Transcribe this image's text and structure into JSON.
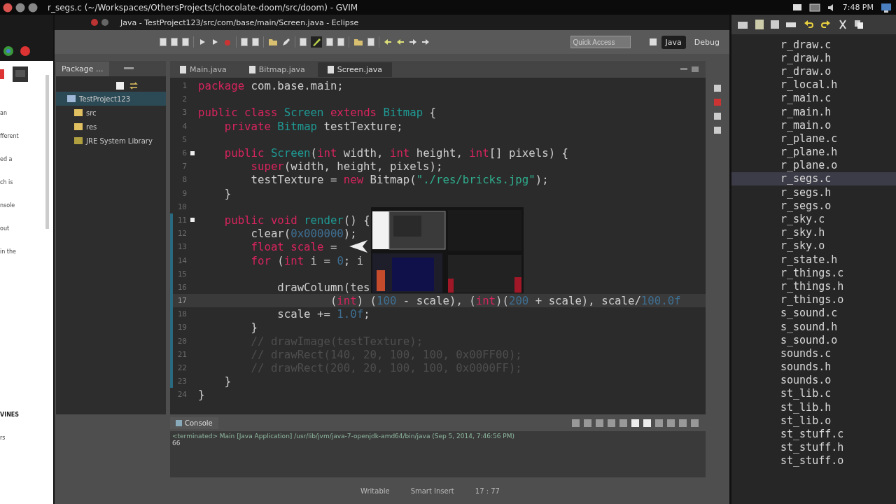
{
  "top_bar": {
    "title": "r_segs.c (~/Workspaces/OthersProjects/chocolate-doom/src/doom) - GVIM",
    "clock": "7:48 PM"
  },
  "left_window": {
    "fragments": [
      "an",
      "fferent",
      "ed a",
      "ch is",
      "nsole",
      "out",
      "in the",
      "VINES",
      "rs"
    ]
  },
  "eclipse": {
    "title": "Java - TestProject123/src/com/base/main/Screen.java - Eclipse",
    "quick_access": {
      "placeholder": "Quick Access"
    },
    "perspectives": [
      {
        "label": "Java",
        "selected": true
      },
      {
        "label": "Debug",
        "selected": false
      }
    ],
    "package_explorer": {
      "tab": "Package ...",
      "tree": [
        {
          "label": "TestProject123",
          "kind": "project",
          "selected": true,
          "children": [
            {
              "label": "src",
              "kind": "folder",
              "selected": false
            },
            {
              "label": "res",
              "kind": "folder",
              "selected": false
            },
            {
              "label": "JRE System Library",
              "kind": "library",
              "selected": false
            }
          ]
        }
      ]
    },
    "editor": {
      "tabs": [
        {
          "label": "Main.java",
          "selected": false
        },
        {
          "label": "Bitmap.java",
          "selected": false
        },
        {
          "label": "Screen.java",
          "selected": true
        }
      ],
      "lines": [
        {
          "number": "1",
          "current": false,
          "marker": false,
          "range": false,
          "tokens": [
            {
              "kind": "keyword",
              "text": "package"
            },
            {
              "kind": "plain",
              "text": " com.base.main;"
            }
          ]
        },
        {
          "number": "2",
          "current": false,
          "marker": false,
          "range": false
        },
        {
          "number": "3",
          "current": false,
          "marker": false,
          "range": false,
          "tokens": [
            {
              "kind": "keyword",
              "text": "public"
            },
            {
              "kind": "keyword",
              "text": " class"
            },
            {
              "kind": "type",
              "text": " Screen"
            },
            {
              "kind": "keyword",
              "text": " extends"
            },
            {
              "kind": "type",
              "text": " Bitmap"
            },
            {
              "kind": "plain",
              "text": " {"
            }
          ]
        },
        {
          "number": "4",
          "current": false,
          "marker": false,
          "range": false,
          "tokens": [
            {
              "kind": "keyword",
              "text": "    private"
            },
            {
              "kind": "type",
              "text": " Bitmap"
            },
            {
              "kind": "plain",
              "text": " testTexture;"
            }
          ]
        },
        {
          "number": "5",
          "current": false,
          "marker": false,
          "range": false
        },
        {
          "number": "6",
          "current": false,
          "marker": true,
          "range": false,
          "tokens": [
            {
              "kind": "keyword",
              "text": "    public"
            },
            {
              "kind": "type",
              "text": " Screen"
            },
            {
              "kind": "plain",
              "text": "("
            },
            {
              "kind": "keyword",
              "text": "int"
            },
            {
              "kind": "plain",
              "text": " width, "
            },
            {
              "kind": "keyword",
              "text": "int"
            },
            {
              "kind": "plain",
              "text": " height, "
            },
            {
              "kind": "keyword",
              "text": "int"
            },
            {
              "kind": "plain",
              "text": "[] pixels) {"
            }
          ]
        },
        {
          "number": "7",
          "current": false,
          "marker": false,
          "range": false,
          "tokens": [
            {
              "kind": "keyword",
              "text": "        super"
            },
            {
              "kind": "plain",
              "text": "(width, height, pixels);"
            }
          ]
        },
        {
          "number": "8",
          "current": false,
          "marker": false,
          "range": false,
          "tokens": [
            {
              "kind": "plain",
              "text": "        testTexture = "
            },
            {
              "kind": "keyword",
              "text": "new"
            },
            {
              "kind": "plain",
              "text": " Bitmap("
            },
            {
              "kind": "string",
              "text": "\"./res/bricks.jpg\""
            },
            {
              "kind": "plain",
              "text": ");"
            }
          ]
        },
        {
          "number": "9",
          "current": false,
          "marker": false,
          "range": false,
          "tokens": [
            {
              "kind": "plain",
              "text": "    }"
            }
          ]
        },
        {
          "number": "10",
          "current": false,
          "marker": false,
          "range": false
        },
        {
          "number": "11",
          "current": false,
          "marker": true,
          "range": true,
          "tokens": [
            {
              "kind": "keyword",
              "text": "    public"
            },
            {
              "kind": "keyword",
              "text": " void"
            },
            {
              "kind": "type",
              "text": " render"
            },
            {
              "kind": "plain",
              "text": "() {"
            }
          ]
        },
        {
          "number": "12",
          "current": false,
          "marker": false,
          "range": true,
          "tokens": [
            {
              "kind": "plain",
              "text": "        clear("
            },
            {
              "kind": "number",
              "text": "0x000000"
            },
            {
              "kind": "plain",
              "text": ");"
            }
          ]
        },
        {
          "number": "13",
          "current": false,
          "marker": false,
          "range": true,
          "tokens": [
            {
              "kind": "keyword",
              "text": "        float"
            },
            {
              "kind": "keyword",
              "text": " scale"
            },
            {
              "kind": "plain",
              "text": " ="
            }
          ]
        },
        {
          "number": "14",
          "current": false,
          "marker": false,
          "range": true,
          "tokens": [
            {
              "kind": "keyword",
              "text": "        for"
            },
            {
              "kind": "plain",
              "text": " ("
            },
            {
              "kind": "keyword",
              "text": "int"
            },
            {
              "kind": "plain",
              "text": " i = "
            },
            {
              "kind": "number",
              "text": "0"
            },
            {
              "kind": "plain",
              "text": "; i"
            }
          ]
        },
        {
          "number": "15",
          "current": false,
          "marker": false,
          "range": true
        },
        {
          "number": "16",
          "current": false,
          "marker": false,
          "range": true,
          "tokens": [
            {
              "kind": "plain",
              "text": "            drawColumn(tes"
            }
          ]
        },
        {
          "number": "17",
          "current": true,
          "marker": false,
          "range": true,
          "tokens": [
            {
              "kind": "plain",
              "text": "                    ("
            },
            {
              "kind": "keyword",
              "text": "int"
            },
            {
              "kind": "plain",
              "text": ") ("
            },
            {
              "kind": "number",
              "text": "100"
            },
            {
              "kind": "plain",
              "text": " - scale), ("
            },
            {
              "kind": "keyword",
              "text": "int"
            },
            {
              "kind": "plain",
              "text": ")("
            },
            {
              "kind": "number",
              "text": "200"
            },
            {
              "kind": "plain",
              "text": " + scale), scale/"
            },
            {
              "kind": "number",
              "text": "100.0f"
            }
          ]
        },
        {
          "number": "18",
          "current": false,
          "marker": false,
          "range": true,
          "tokens": [
            {
              "kind": "plain",
              "text": "            scale += "
            },
            {
              "kind": "number",
              "text": "1.0f"
            },
            {
              "kind": "plain",
              "text": ";"
            }
          ]
        },
        {
          "number": "19",
          "current": false,
          "marker": false,
          "range": true,
          "tokens": [
            {
              "kind": "plain",
              "text": "        }"
            }
          ]
        },
        {
          "number": "20",
          "current": false,
          "marker": false,
          "range": true,
          "tokens": [
            {
              "kind": "comment",
              "text": "        // drawImage(testTexture);"
            }
          ]
        },
        {
          "number": "21",
          "current": false,
          "marker": false,
          "range": true,
          "tokens": [
            {
              "kind": "comment",
              "text": "        // drawRect(140, 20, 100, 100, 0x00FF00);"
            }
          ]
        },
        {
          "number": "22",
          "current": false,
          "marker": false,
          "range": true,
          "tokens": [
            {
              "kind": "comment",
              "text": "        // drawRect(200, 20, 100, 100, 0x0000FF);"
            }
          ]
        },
        {
          "number": "23",
          "current": false,
          "marker": false,
          "range": true,
          "tokens": [
            {
              "kind": "plain",
              "text": "    }"
            }
          ]
        },
        {
          "number": "24",
          "current": false,
          "marker": false,
          "range": false,
          "tokens": [
            {
              "kind": "plain",
              "text": "}"
            }
          ]
        }
      ]
    },
    "console": {
      "tab": "Console",
      "lines": [
        "<terminated> Main [Java Application] /usr/lib/jvm/java-7-openjdk-amd64/bin/java (Sep 5, 2014, 7:46:56 PM)",
        "66"
      ]
    },
    "status_bar": [
      "Writable",
      "Smart Insert",
      "17 : 77"
    ]
  },
  "gvim": {
    "files": [
      {
        "name": "r_draw.c",
        "selected": false
      },
      {
        "name": "r_draw.h",
        "selected": false
      },
      {
        "name": "r_draw.o",
        "selected": false
      },
      {
        "name": "r_local.h",
        "selected": false
      },
      {
        "name": "r_main.c",
        "selected": false
      },
      {
        "name": "r_main.h",
        "selected": false
      },
      {
        "name": "r_main.o",
        "selected": false
      },
      {
        "name": "r_plane.c",
        "selected": false
      },
      {
        "name": "r_plane.h",
        "selected": false
      },
      {
        "name": "r_plane.o",
        "selected": false
      },
      {
        "name": "r_segs.c",
        "selected": true
      },
      {
        "name": "r_segs.h",
        "selected": false
      },
      {
        "name": "r_segs.o",
        "selected": false
      },
      {
        "name": "r_sky.c",
        "selected": false
      },
      {
        "name": "r_sky.h",
        "selected": false
      },
      {
        "name": "r_sky.o",
        "selected": false
      },
      {
        "name": "r_state.h",
        "selected": false
      },
      {
        "name": "r_things.c",
        "selected": false
      },
      {
        "name": "r_things.h",
        "selected": false
      },
      {
        "name": "r_things.o",
        "selected": false
      },
      {
        "name": "s_sound.c",
        "selected": false
      },
      {
        "name": "s_sound.h",
        "selected": false
      },
      {
        "name": "s_sound.o",
        "selected": false
      },
      {
        "name": "sounds.c",
        "selected": false
      },
      {
        "name": "sounds.h",
        "selected": false
      },
      {
        "name": "sounds.o",
        "selected": false
      },
      {
        "name": "st_lib.c",
        "selected": false
      },
      {
        "name": "st_lib.h",
        "selected": false
      },
      {
        "name": "st_lib.o",
        "selected": false
      },
      {
        "name": "st_stuff.c",
        "selected": false
      },
      {
        "name": "st_stuff.h",
        "selected": false
      },
      {
        "name": "st_stuff.o",
        "selected": false
      }
    ]
  }
}
